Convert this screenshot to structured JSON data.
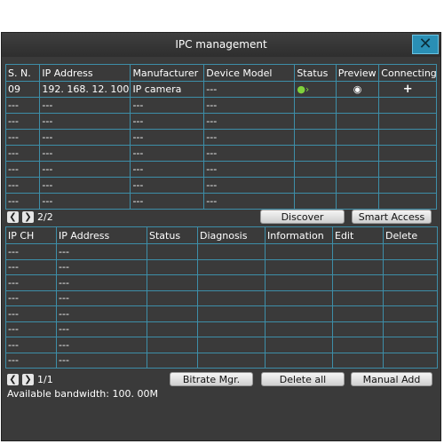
{
  "window": {
    "title": "IPC management",
    "close_glyph": "✕"
  },
  "top_table": {
    "headers": [
      "S. N.",
      "IP Address",
      "Manufacturer",
      "Device Model",
      "Status",
      "Preview",
      "Connecting"
    ],
    "row1": {
      "sn": "09",
      "ip": "192. 168. 12. 100",
      "manufacturer": "IP camera",
      "model": "---",
      "status_icon": "user-online-icon",
      "preview_icon": "eye-icon",
      "connect_icon": "plus-icon"
    },
    "empty_cell": "---",
    "empty_rows": 7
  },
  "top_nav": {
    "prev": "❮",
    "next": "❯",
    "page": "2/2"
  },
  "buttons": {
    "discover": "Discover",
    "smart_access": "Smart Access",
    "bitrate": "Bitrate Mgr.",
    "delete_all": "Delete all",
    "manual_add": "Manual Add"
  },
  "bottom_table": {
    "headers": [
      "IP CH",
      "IP Address",
      "Status",
      "Diagnosis",
      "Information",
      "Edit",
      "Delete"
    ],
    "empty_cell": "---",
    "empty_rows": 8
  },
  "bottom_nav": {
    "prev": "❮",
    "next": "❯",
    "page": "1/1"
  },
  "bandwidth": "Available bandwidth: 100. 00M",
  "colors": {
    "bg": "#3a3a3a",
    "grid": "#3d8ea8",
    "accent": "#2a8fb5",
    "online": "#7fd23c"
  }
}
